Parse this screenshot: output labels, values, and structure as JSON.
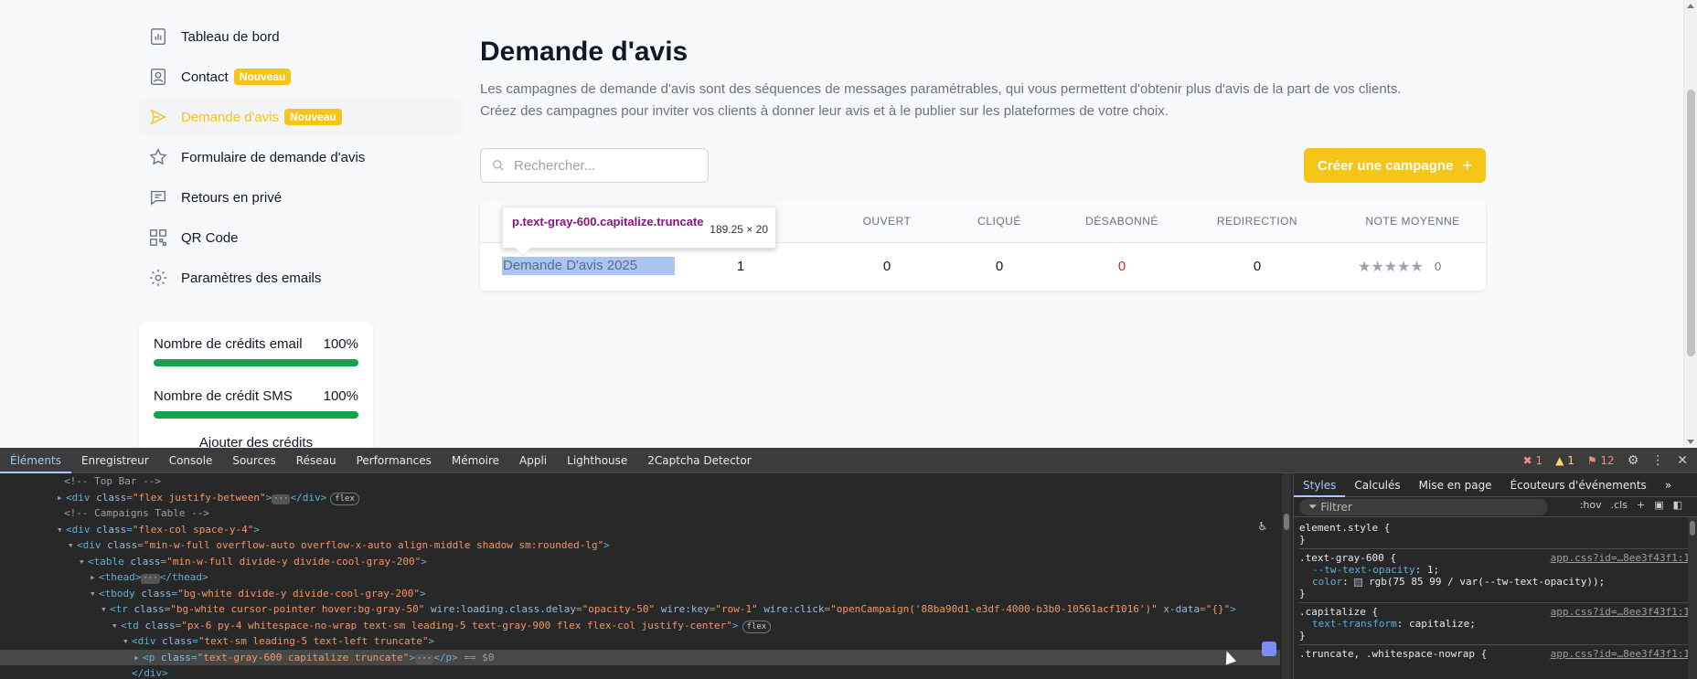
{
  "sidebar": {
    "items": [
      {
        "label": "Tableau de bord",
        "icon": "bar-chart-icon"
      },
      {
        "label": "Contact",
        "badge": "Nouveau",
        "icon": "contact-card-icon"
      },
      {
        "label": "Demande d'avis",
        "badge": "Nouveau",
        "icon": "send-icon",
        "active": true
      },
      {
        "label": "Formulaire de demande d'avis",
        "icon": "star-icon"
      },
      {
        "label": "Retours en privé",
        "icon": "chat-icon"
      },
      {
        "label": "QR Code",
        "icon": "qr-code-icon"
      },
      {
        "label": "Paramètres des emails",
        "icon": "gear-icon"
      }
    ]
  },
  "credits": {
    "email_label": "Nombre de crédits email",
    "email_value": "100%",
    "email_fraction": 1.0,
    "sms_label": "Nombre de crédit SMS",
    "sms_value": "100%",
    "sms_fraction": 1.0,
    "add_link": "Ajouter des crédits"
  },
  "main": {
    "title": "Demande d'avis",
    "desc_line1": "Les campagnes de demande d'avis sont des séquences de messages paramétrables, qui vous permettent d'obtenir plus d'avis de la part de vos clients.",
    "desc_line2": "Créez des campagnes pour inviter vos clients à donner leur avis et à le publier sur les plateformes de votre choix.",
    "search_placeholder": "Rechercher...",
    "create_button": "Créer une campagne",
    "create_button_icon": "+"
  },
  "table": {
    "headers": [
      "Ouvert",
      "Cliqué",
      "Désabonné",
      "Redirection",
      "Note moyenne"
    ],
    "row": {
      "name": "Demande D'avis 2025",
      "sent": "1",
      "opened": "0",
      "clicked": "0",
      "unsubscribed": "0",
      "redirection": "0",
      "stars": "★★★★★",
      "rating": "0"
    }
  },
  "tooltip": {
    "selector": "p.text-gray-600.capitalize.truncate",
    "dimensions": "189.25 × 20"
  },
  "devtools": {
    "tabs": [
      "Éléments",
      "Enregistreur",
      "Console",
      "Sources",
      "Réseau",
      "Performances",
      "Mémoire",
      "Appli",
      "Lighthouse",
      "2Captcha Detector"
    ],
    "errors": "1",
    "warnings": "1",
    "issues": "12",
    "styles_tabs": [
      "Styles",
      "Calculés",
      "Mise en page",
      "Écouteurs d'événements"
    ],
    "filter_placeholder": "Filtrer",
    "hov": ":hov",
    "cls": ".cls",
    "dom": {
      "l0": "<!-- Top Bar -->",
      "l1_tag": "div",
      "l1_attr": "class",
      "l1_val": "\"flex justify-between\"",
      "l1_pill": "flex",
      "l2": "<!-- Campaigns Table -->",
      "l3_val": "\"flex-col space-y-4\"",
      "l4_val": "\"min-w-full overflow-auto overflow-x-auto align-middle shadow sm:rounded-lg\"",
      "l5_val": "\"min-w-full divide-y divide-cool-gray-200\"",
      "l6": "thead",
      "l7_val": "\"bg-white divide-y divide-cool-gray-200\"",
      "l8_val": "\"bg-white cursor-pointer hover:bg-gray-50\"",
      "l8_rest1": "wire:loading.class.delay",
      "l8_rest1v": "\"opacity-50\"",
      "l8_rest2": "wire:key",
      "l8_rest2v": "\"row-1\"",
      "l8_rest3": "wire:click",
      "l8_rest3v": "\"openCampaign('88ba90d1-e3df-4000-b3b0-10561acf1016')\"",
      "l8_rest4": "x-data",
      "l8_rest4v": "\"{}\"",
      "l9_val": "\"px-6 py-4 whitespace-no-wrap text-sm leading-5 text-gray-900 flex flex-col justify-center\"",
      "l9_pill": "flex",
      "l10_val": "\"text-sm leading-5 text-left truncate\"",
      "l11_val": "\"text-gray-600 capitalize truncate\"",
      "l11_eq": "== $0",
      "l12": "</div>"
    },
    "css": {
      "element_style": "element.style {",
      "r1_sel": ".text-gray-600 {",
      "r1_src": "app.css?id=…8ee3f43f1:1",
      "r1_p1": "--tw-text-opacity",
      "r1_v1": "1;",
      "r1_p2": "color",
      "r1_v2": "rgb(75 85 99 / var(--tw-text-opacity));",
      "r2_sel": ".capitalize {",
      "r2_src": "app.css?id=…8ee3f43f1:1",
      "r2_p1": "text-transform",
      "r2_v1": "capitalize;",
      "r3_sel": ".truncate, .whitespace-nowrap {",
      "r3_src": "app.css?id=…8ee3f43f1:1"
    }
  }
}
